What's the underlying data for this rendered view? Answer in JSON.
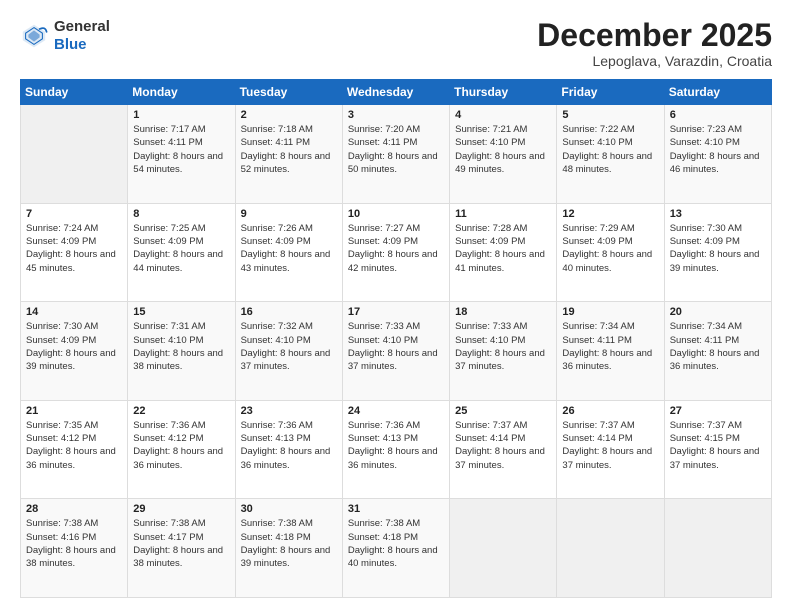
{
  "header": {
    "logo_line1": "General",
    "logo_line2": "Blue",
    "month_title": "December 2025",
    "location": "Lepoglava, Varazdin, Croatia"
  },
  "weekdays": [
    "Sunday",
    "Monday",
    "Tuesday",
    "Wednesday",
    "Thursday",
    "Friday",
    "Saturday"
  ],
  "weeks": [
    [
      {
        "day": "",
        "sunrise": "",
        "sunset": "",
        "daylight": ""
      },
      {
        "day": "1",
        "sunrise": "Sunrise: 7:17 AM",
        "sunset": "Sunset: 4:11 PM",
        "daylight": "Daylight: 8 hours and 54 minutes."
      },
      {
        "day": "2",
        "sunrise": "Sunrise: 7:18 AM",
        "sunset": "Sunset: 4:11 PM",
        "daylight": "Daylight: 8 hours and 52 minutes."
      },
      {
        "day": "3",
        "sunrise": "Sunrise: 7:20 AM",
        "sunset": "Sunset: 4:11 PM",
        "daylight": "Daylight: 8 hours and 50 minutes."
      },
      {
        "day": "4",
        "sunrise": "Sunrise: 7:21 AM",
        "sunset": "Sunset: 4:10 PM",
        "daylight": "Daylight: 8 hours and 49 minutes."
      },
      {
        "day": "5",
        "sunrise": "Sunrise: 7:22 AM",
        "sunset": "Sunset: 4:10 PM",
        "daylight": "Daylight: 8 hours and 48 minutes."
      },
      {
        "day": "6",
        "sunrise": "Sunrise: 7:23 AM",
        "sunset": "Sunset: 4:10 PM",
        "daylight": "Daylight: 8 hours and 46 minutes."
      }
    ],
    [
      {
        "day": "7",
        "sunrise": "Sunrise: 7:24 AM",
        "sunset": "Sunset: 4:09 PM",
        "daylight": "Daylight: 8 hours and 45 minutes."
      },
      {
        "day": "8",
        "sunrise": "Sunrise: 7:25 AM",
        "sunset": "Sunset: 4:09 PM",
        "daylight": "Daylight: 8 hours and 44 minutes."
      },
      {
        "day": "9",
        "sunrise": "Sunrise: 7:26 AM",
        "sunset": "Sunset: 4:09 PM",
        "daylight": "Daylight: 8 hours and 43 minutes."
      },
      {
        "day": "10",
        "sunrise": "Sunrise: 7:27 AM",
        "sunset": "Sunset: 4:09 PM",
        "daylight": "Daylight: 8 hours and 42 minutes."
      },
      {
        "day": "11",
        "sunrise": "Sunrise: 7:28 AM",
        "sunset": "Sunset: 4:09 PM",
        "daylight": "Daylight: 8 hours and 41 minutes."
      },
      {
        "day": "12",
        "sunrise": "Sunrise: 7:29 AM",
        "sunset": "Sunset: 4:09 PM",
        "daylight": "Daylight: 8 hours and 40 minutes."
      },
      {
        "day": "13",
        "sunrise": "Sunrise: 7:30 AM",
        "sunset": "Sunset: 4:09 PM",
        "daylight": "Daylight: 8 hours and 39 minutes."
      }
    ],
    [
      {
        "day": "14",
        "sunrise": "Sunrise: 7:30 AM",
        "sunset": "Sunset: 4:09 PM",
        "daylight": "Daylight: 8 hours and 39 minutes."
      },
      {
        "day": "15",
        "sunrise": "Sunrise: 7:31 AM",
        "sunset": "Sunset: 4:10 PM",
        "daylight": "Daylight: 8 hours and 38 minutes."
      },
      {
        "day": "16",
        "sunrise": "Sunrise: 7:32 AM",
        "sunset": "Sunset: 4:10 PM",
        "daylight": "Daylight: 8 hours and 37 minutes."
      },
      {
        "day": "17",
        "sunrise": "Sunrise: 7:33 AM",
        "sunset": "Sunset: 4:10 PM",
        "daylight": "Daylight: 8 hours and 37 minutes."
      },
      {
        "day": "18",
        "sunrise": "Sunrise: 7:33 AM",
        "sunset": "Sunset: 4:10 PM",
        "daylight": "Daylight: 8 hours and 37 minutes."
      },
      {
        "day": "19",
        "sunrise": "Sunrise: 7:34 AM",
        "sunset": "Sunset: 4:11 PM",
        "daylight": "Daylight: 8 hours and 36 minutes."
      },
      {
        "day": "20",
        "sunrise": "Sunrise: 7:34 AM",
        "sunset": "Sunset: 4:11 PM",
        "daylight": "Daylight: 8 hours and 36 minutes."
      }
    ],
    [
      {
        "day": "21",
        "sunrise": "Sunrise: 7:35 AM",
        "sunset": "Sunset: 4:12 PM",
        "daylight": "Daylight: 8 hours and 36 minutes."
      },
      {
        "day": "22",
        "sunrise": "Sunrise: 7:36 AM",
        "sunset": "Sunset: 4:12 PM",
        "daylight": "Daylight: 8 hours and 36 minutes."
      },
      {
        "day": "23",
        "sunrise": "Sunrise: 7:36 AM",
        "sunset": "Sunset: 4:13 PM",
        "daylight": "Daylight: 8 hours and 36 minutes."
      },
      {
        "day": "24",
        "sunrise": "Sunrise: 7:36 AM",
        "sunset": "Sunset: 4:13 PM",
        "daylight": "Daylight: 8 hours and 36 minutes."
      },
      {
        "day": "25",
        "sunrise": "Sunrise: 7:37 AM",
        "sunset": "Sunset: 4:14 PM",
        "daylight": "Daylight: 8 hours and 37 minutes."
      },
      {
        "day": "26",
        "sunrise": "Sunrise: 7:37 AM",
        "sunset": "Sunset: 4:14 PM",
        "daylight": "Daylight: 8 hours and 37 minutes."
      },
      {
        "day": "27",
        "sunrise": "Sunrise: 7:37 AM",
        "sunset": "Sunset: 4:15 PM",
        "daylight": "Daylight: 8 hours and 37 minutes."
      }
    ],
    [
      {
        "day": "28",
        "sunrise": "Sunrise: 7:38 AM",
        "sunset": "Sunset: 4:16 PM",
        "daylight": "Daylight: 8 hours and 38 minutes."
      },
      {
        "day": "29",
        "sunrise": "Sunrise: 7:38 AM",
        "sunset": "Sunset: 4:17 PM",
        "daylight": "Daylight: 8 hours and 38 minutes."
      },
      {
        "day": "30",
        "sunrise": "Sunrise: 7:38 AM",
        "sunset": "Sunset: 4:18 PM",
        "daylight": "Daylight: 8 hours and 39 minutes."
      },
      {
        "day": "31",
        "sunrise": "Sunrise: 7:38 AM",
        "sunset": "Sunset: 4:18 PM",
        "daylight": "Daylight: 8 hours and 40 minutes."
      },
      {
        "day": "",
        "sunrise": "",
        "sunset": "",
        "daylight": ""
      },
      {
        "day": "",
        "sunrise": "",
        "sunset": "",
        "daylight": ""
      },
      {
        "day": "",
        "sunrise": "",
        "sunset": "",
        "daylight": ""
      }
    ]
  ]
}
